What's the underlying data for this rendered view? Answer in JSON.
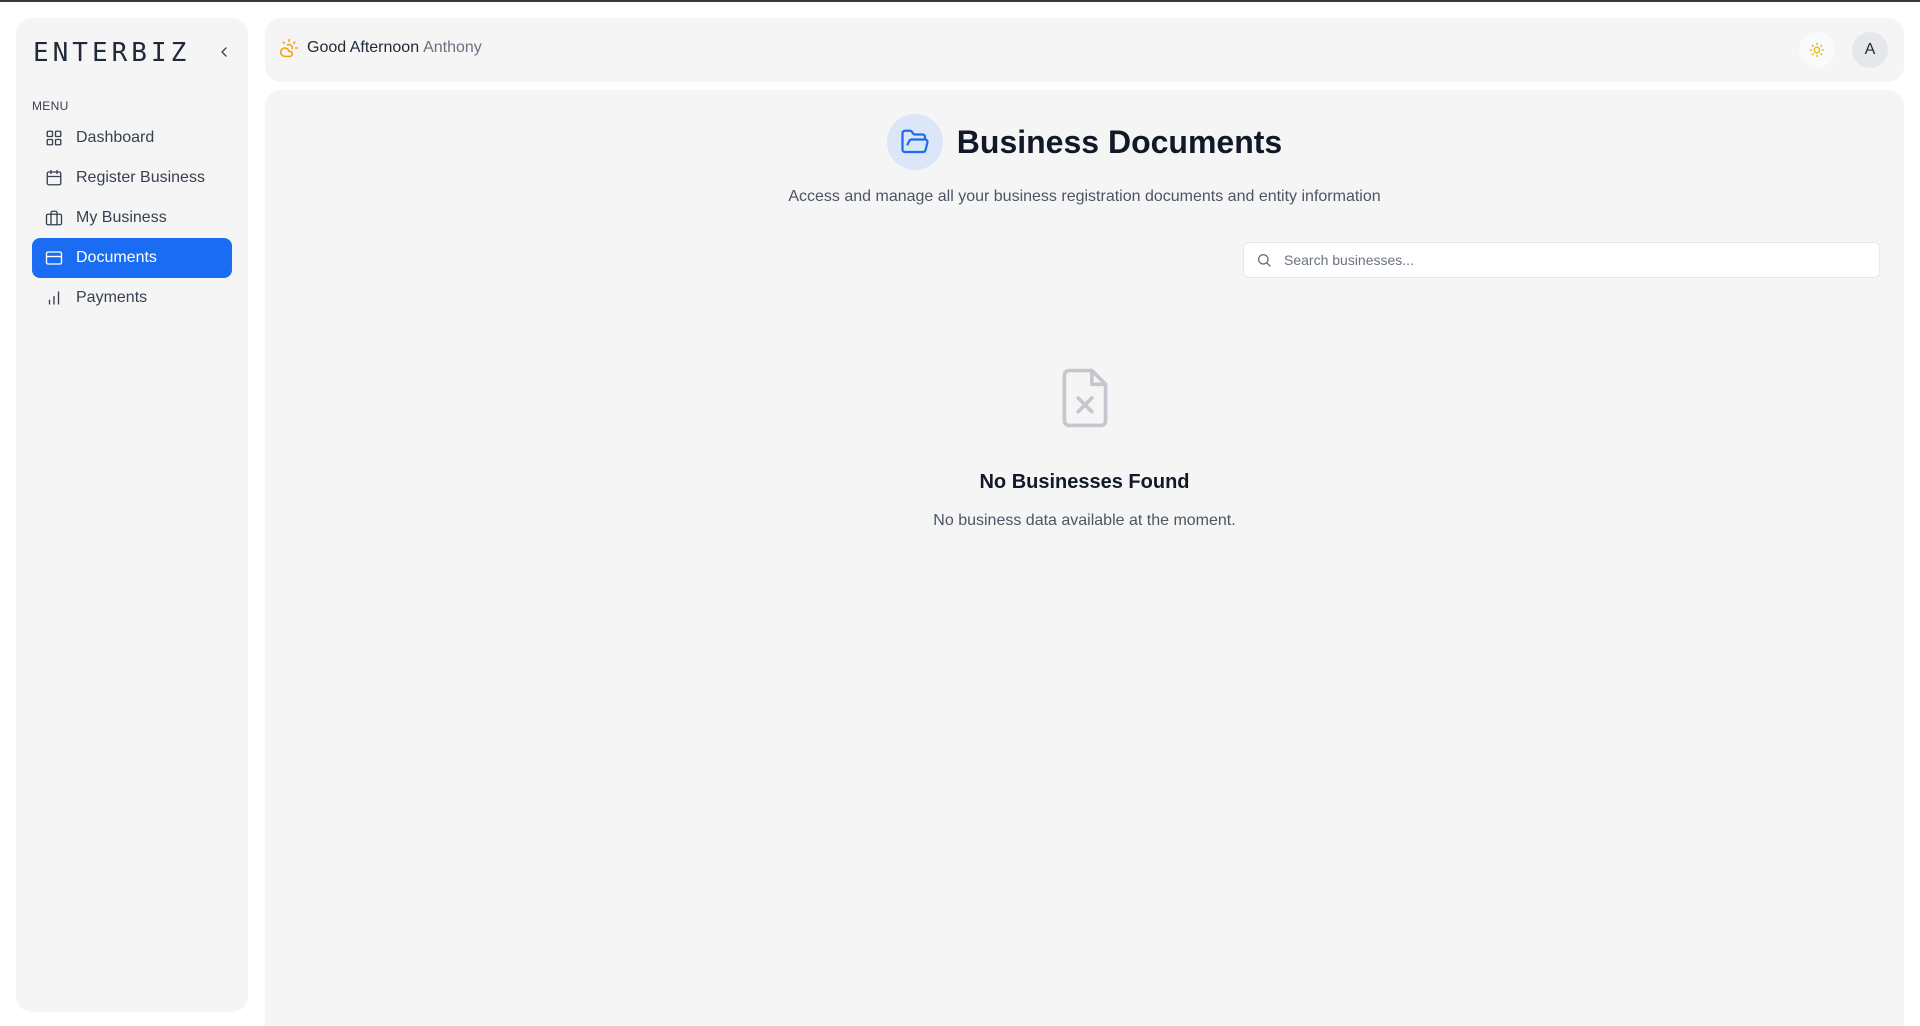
{
  "app": {
    "logo": "ENTERBIZ"
  },
  "sidebar": {
    "menu_label": "MENU",
    "items": [
      {
        "label": "Dashboard",
        "icon": "grid-icon",
        "active": false
      },
      {
        "label": "Register Business",
        "icon": "calendar-icon",
        "active": false
      },
      {
        "label": "My Business",
        "icon": "briefcase-icon",
        "active": false
      },
      {
        "label": "Documents",
        "icon": "card-icon",
        "active": true
      },
      {
        "label": "Payments",
        "icon": "bar-chart-icon",
        "active": false
      }
    ]
  },
  "header": {
    "greeting": "Good Afternoon",
    "user_name": "Anthony",
    "avatar_initial": "A"
  },
  "main": {
    "title": "Business Documents",
    "subtitle": "Access and manage all your business registration documents and entity information",
    "search": {
      "placeholder": "Search businesses...",
      "value": ""
    },
    "empty_state": {
      "title": "No Businesses Found",
      "message": "No business data available at the moment."
    }
  },
  "colors": {
    "accent": "#1a6df2",
    "panel_bg": "#f5f5f5",
    "greeting_icon": "#f59e0b"
  }
}
